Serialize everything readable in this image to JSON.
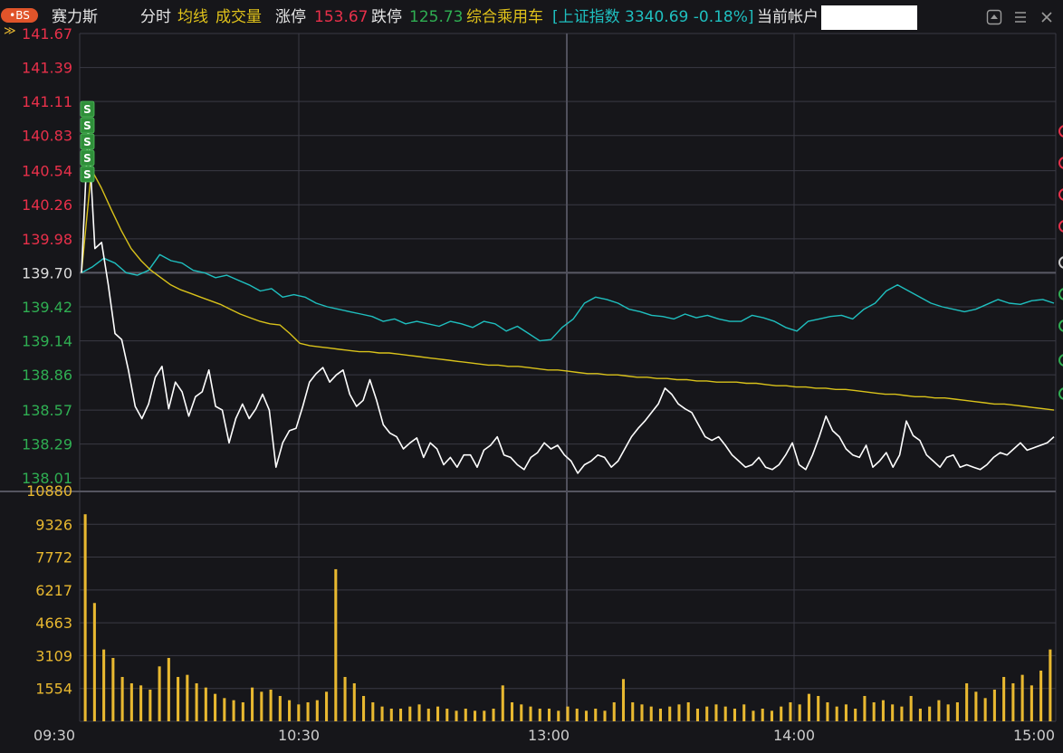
{
  "header": {
    "badge": "•BS",
    "stock_name": "赛力斯",
    "mode_label": "分时",
    "avg_label": "均线",
    "volume_label": "成交量",
    "limit_up_label": "涨停",
    "limit_up_value": "153.67",
    "limit_down_label": "跌停",
    "limit_down_value": "125.73",
    "sector": "综合乘用车",
    "index_text": "[上证指数 3340.69 -0.18%]",
    "account_label": "当前帐户",
    "expand_icon": "chevron-double-down-icon",
    "icons": [
      "pin-icon",
      "menu-icon"
    ]
  },
  "colors": {
    "background": "#16161a",
    "price_line": "#ffffff",
    "avg_line": "#d9c21a",
    "index_line": "#1fbfbf",
    "up": "#e8304a",
    "down": "#2fae52",
    "neutral": "#dddddd",
    "volume": "#e8b830",
    "grid": "#3a3a44",
    "sell_marker": "#2f8f3a"
  },
  "chart_data": {
    "type": "line",
    "price_axis": {
      "ticks": [
        "141.67",
        "141.39",
        "141.11",
        "140.83",
        "140.54",
        "140.26",
        "139.98",
        "139.70",
        "139.42",
        "139.14",
        "138.86",
        "138.57",
        "138.29",
        "138.01"
      ],
      "prev_close": "139.70",
      "range": [
        137.9,
        141.67
      ]
    },
    "volume_axis": {
      "ticks": [
        "10880",
        "9326",
        "7772",
        "6217",
        "4663",
        "3109",
        "1554"
      ],
      "range": [
        0,
        10880
      ]
    },
    "time_labels": [
      "09:30",
      "10:30",
      "13:00",
      "14:00",
      "15:00"
    ],
    "sell_markers": [
      "S",
      "S",
      "S",
      "S",
      "S"
    ],
    "series": [
      {
        "name": "分时",
        "values": [
          139.7,
          140.9,
          139.9,
          139.95,
          139.6,
          139.2,
          139.15,
          138.9,
          138.6,
          138.5,
          138.62,
          138.84,
          138.93,
          138.58,
          138.8,
          138.72,
          138.52,
          138.68,
          138.72,
          138.9,
          138.6,
          138.57,
          138.3,
          138.5,
          138.62,
          138.5,
          138.58,
          138.7,
          138.57,
          138.1,
          138.3,
          138.4,
          138.42,
          138.6,
          138.8,
          138.87,
          138.92,
          138.8,
          138.86,
          138.9,
          138.7,
          138.6,
          138.65,
          138.82,
          138.65,
          138.45,
          138.38,
          138.35,
          138.25,
          138.3,
          138.34,
          138.18,
          138.3,
          138.25,
          138.12,
          138.18,
          138.1,
          138.2,
          138.2,
          138.1,
          138.24,
          138.28,
          138.35,
          138.2,
          138.18,
          138.12,
          138.08,
          138.18,
          138.22,
          138.3,
          138.25,
          138.28,
          138.2,
          138.15,
          138.05,
          138.12,
          138.15,
          138.2,
          138.18,
          138.1,
          138.15,
          138.25,
          138.35,
          138.42,
          138.48,
          138.55,
          138.62,
          138.75,
          138.7,
          138.62,
          138.58,
          138.55,
          138.45,
          138.35,
          138.32,
          138.35,
          138.28,
          138.2,
          138.15,
          138.1,
          138.12,
          138.18,
          138.1,
          138.08,
          138.12,
          138.2,
          138.3,
          138.12,
          138.08,
          138.2,
          138.35,
          138.52,
          138.4,
          138.35,
          138.25,
          138.2,
          138.18,
          138.28,
          138.1,
          138.15,
          138.22,
          138.1,
          138.2,
          138.48,
          138.36,
          138.32,
          138.2,
          138.15,
          138.1,
          138.18,
          138.2,
          138.1,
          138.12,
          138.1,
          138.08,
          138.12,
          138.18,
          138.22,
          138.2,
          138.25,
          138.3,
          138.24,
          138.26,
          138.28,
          138.3,
          138.35
        ]
      },
      {
        "name": "均线",
        "values": [
          139.7,
          140.55,
          140.4,
          140.22,
          140.05,
          139.9,
          139.8,
          139.72,
          139.66,
          139.6,
          139.56,
          139.53,
          139.5,
          139.47,
          139.44,
          139.4,
          139.36,
          139.33,
          139.3,
          139.28,
          139.27,
          139.2,
          139.12,
          139.1,
          139.09,
          139.08,
          139.07,
          139.06,
          139.05,
          139.05,
          139.04,
          139.04,
          139.03,
          139.02,
          139.01,
          139.0,
          138.99,
          138.98,
          138.97,
          138.96,
          138.95,
          138.94,
          138.94,
          138.93,
          138.93,
          138.92,
          138.91,
          138.9,
          138.9,
          138.89,
          138.88,
          138.87,
          138.87,
          138.86,
          138.86,
          138.85,
          138.84,
          138.84,
          138.83,
          138.83,
          138.82,
          138.82,
          138.81,
          138.81,
          138.8,
          138.8,
          138.8,
          138.79,
          138.79,
          138.78,
          138.77,
          138.77,
          138.76,
          138.76,
          138.75,
          138.75,
          138.74,
          138.74,
          138.73,
          138.72,
          138.71,
          138.7,
          138.7,
          138.69,
          138.68,
          138.68,
          138.67,
          138.67,
          138.66,
          138.65,
          138.64,
          138.63,
          138.62,
          138.62,
          138.61,
          138.6,
          138.59,
          138.58,
          138.57
        ]
      },
      {
        "name": "上证指数",
        "values": [
          139.7,
          139.75,
          139.82,
          139.78,
          139.7,
          139.68,
          139.72,
          139.85,
          139.8,
          139.78,
          139.72,
          139.7,
          139.66,
          139.68,
          139.64,
          139.6,
          139.55,
          139.57,
          139.5,
          139.52,
          139.5,
          139.45,
          139.42,
          139.4,
          139.38,
          139.36,
          139.34,
          139.3,
          139.32,
          139.28,
          139.3,
          139.28,
          139.26,
          139.3,
          139.28,
          139.25,
          139.3,
          139.28,
          139.22,
          139.26,
          139.2,
          139.14,
          139.15,
          139.25,
          139.32,
          139.45,
          139.5,
          139.48,
          139.45,
          139.4,
          139.38,
          139.35,
          139.34,
          139.32,
          139.36,
          139.33,
          139.35,
          139.32,
          139.3,
          139.3,
          139.35,
          139.33,
          139.3,
          139.25,
          139.22,
          139.3,
          139.32,
          139.34,
          139.35,
          139.32,
          139.4,
          139.45,
          139.55,
          139.6,
          139.55,
          139.5,
          139.45,
          139.42,
          139.4,
          139.38,
          139.4,
          139.44,
          139.48,
          139.45,
          139.44,
          139.47,
          139.48,
          139.45
        ]
      }
    ],
    "volume": [
      9800,
      5600,
      3400,
      3000,
      2100,
      1800,
      1700,
      1500,
      2600,
      3000,
      2100,
      2200,
      1800,
      1600,
      1300,
      1100,
      1000,
      900,
      1600,
      1400,
      1500,
      1200,
      1000,
      800,
      900,
      1000,
      1400,
      7200,
      2100,
      1800,
      1200,
      900,
      700,
      600,
      600,
      700,
      800,
      600,
      700,
      600,
      500,
      600,
      500,
      500,
      600,
      1700,
      900,
      800,
      700,
      600,
      600,
      500,
      700,
      600,
      500,
      600,
      500,
      900,
      2000,
      900,
      800,
      700,
      600,
      700,
      800,
      900,
      600,
      700,
      800,
      700,
      600,
      800,
      500,
      600,
      500,
      700,
      900,
      800,
      1300,
      1200,
      900,
      700,
      800,
      600,
      1200,
      900,
      1000,
      800,
      700,
      1200,
      600,
      700,
      1000,
      800,
      900,
      1800,
      1400,
      1100,
      1500,
      2100,
      1800,
      2200,
      1700,
      2400,
      3400
    ]
  }
}
